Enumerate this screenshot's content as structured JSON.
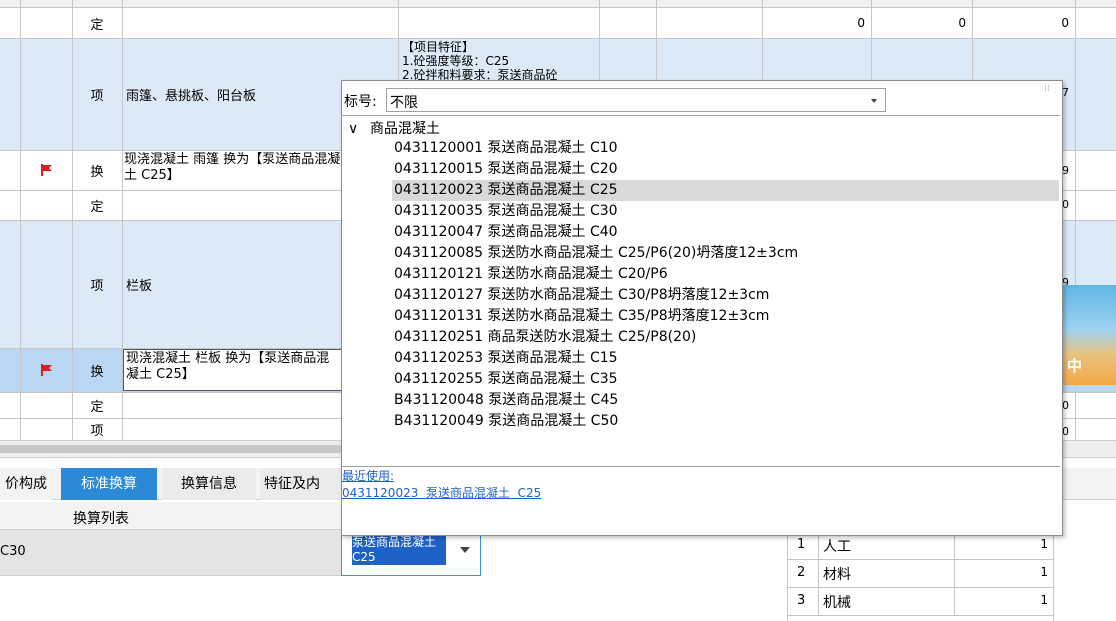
{
  "grid": {
    "rows": [
      {
        "type": "定",
        "name": "",
        "feature": "",
        "n1": "0",
        "n2": "0",
        "n3": "0"
      },
      {
        "type": "项",
        "name": "雨篷、悬挑板、阳台板",
        "feature": "【项目特征】\n1.砼强度等级：C25\n2.砼拌和料要求：泵送商品砼",
        "n3": "7"
      },
      {
        "type": "换",
        "name": "现浇混凝土 雨篷  换为【泵送商品混凝土 C25】",
        "n3": "9"
      },
      {
        "type": "定",
        "name": "",
        "n3": "0"
      },
      {
        "type": "项",
        "name": "栏板",
        "n3": "9"
      },
      {
        "type": "换",
        "name": "现浇混凝土 栏板  换为【泵送商品混凝土 C25】",
        "n3": ""
      },
      {
        "type": "定",
        "name": "",
        "n3": "0"
      },
      {
        "type": "项",
        "name": "",
        "n3": "0"
      }
    ]
  },
  "dropdown": {
    "filter_label": "标号:",
    "filter_value": "不限",
    "group_label": "商品混凝土",
    "items": [
      "0431120001  泵送商品混凝土 C10",
      "0431120015  泵送商品混凝土 C20",
      "0431120023  泵送商品混凝土 C25",
      "0431120035  泵送商品混凝土 C30",
      "0431120047  泵送商品混凝土 C40",
      "0431120085  泵送防水商品混凝土 C25/P6(20)坍落度12±3cm",
      "0431120121  泵送防水商品混凝土 C20/P6",
      "0431120127  泵送防水商品混凝土 C30/P8坍落度12±3cm",
      "0431120131  泵送防水商品混凝土 C35/P8坍落度12±3cm",
      "0431120251  商品泵送防水混凝土 C25/P8(20)",
      "0431120253  泵送商品混凝土 C15",
      "0431120255  泵送商品混凝土 C35",
      "B431120048  泵送商品混凝土 C45",
      "B431120049  泵送商品混凝土 C50"
    ],
    "selected_index": 2,
    "recent_label": "最近使用:",
    "recent_item": "0431120023  泵送商品混凝土  C25"
  },
  "tabs": [
    "价构成",
    "标准换算",
    "换算信息",
    "特征及内"
  ],
  "active_tab": 1,
  "bottom": {
    "list_header": "换算列表",
    "list_row": "C30",
    "combo_value": "泵送商品混凝土 C25"
  },
  "mini_table": [
    {
      "idx": "1",
      "name": "人工",
      "val": "1"
    },
    {
      "idx": "2",
      "name": "材料",
      "val": "1"
    },
    {
      "idx": "3",
      "name": "机械",
      "val": "1"
    }
  ],
  "overlay_text": "中",
  "colors": {
    "tab_active": "#2b8ad8",
    "accent": "#1f62c6",
    "flag": "#d91e1e"
  }
}
